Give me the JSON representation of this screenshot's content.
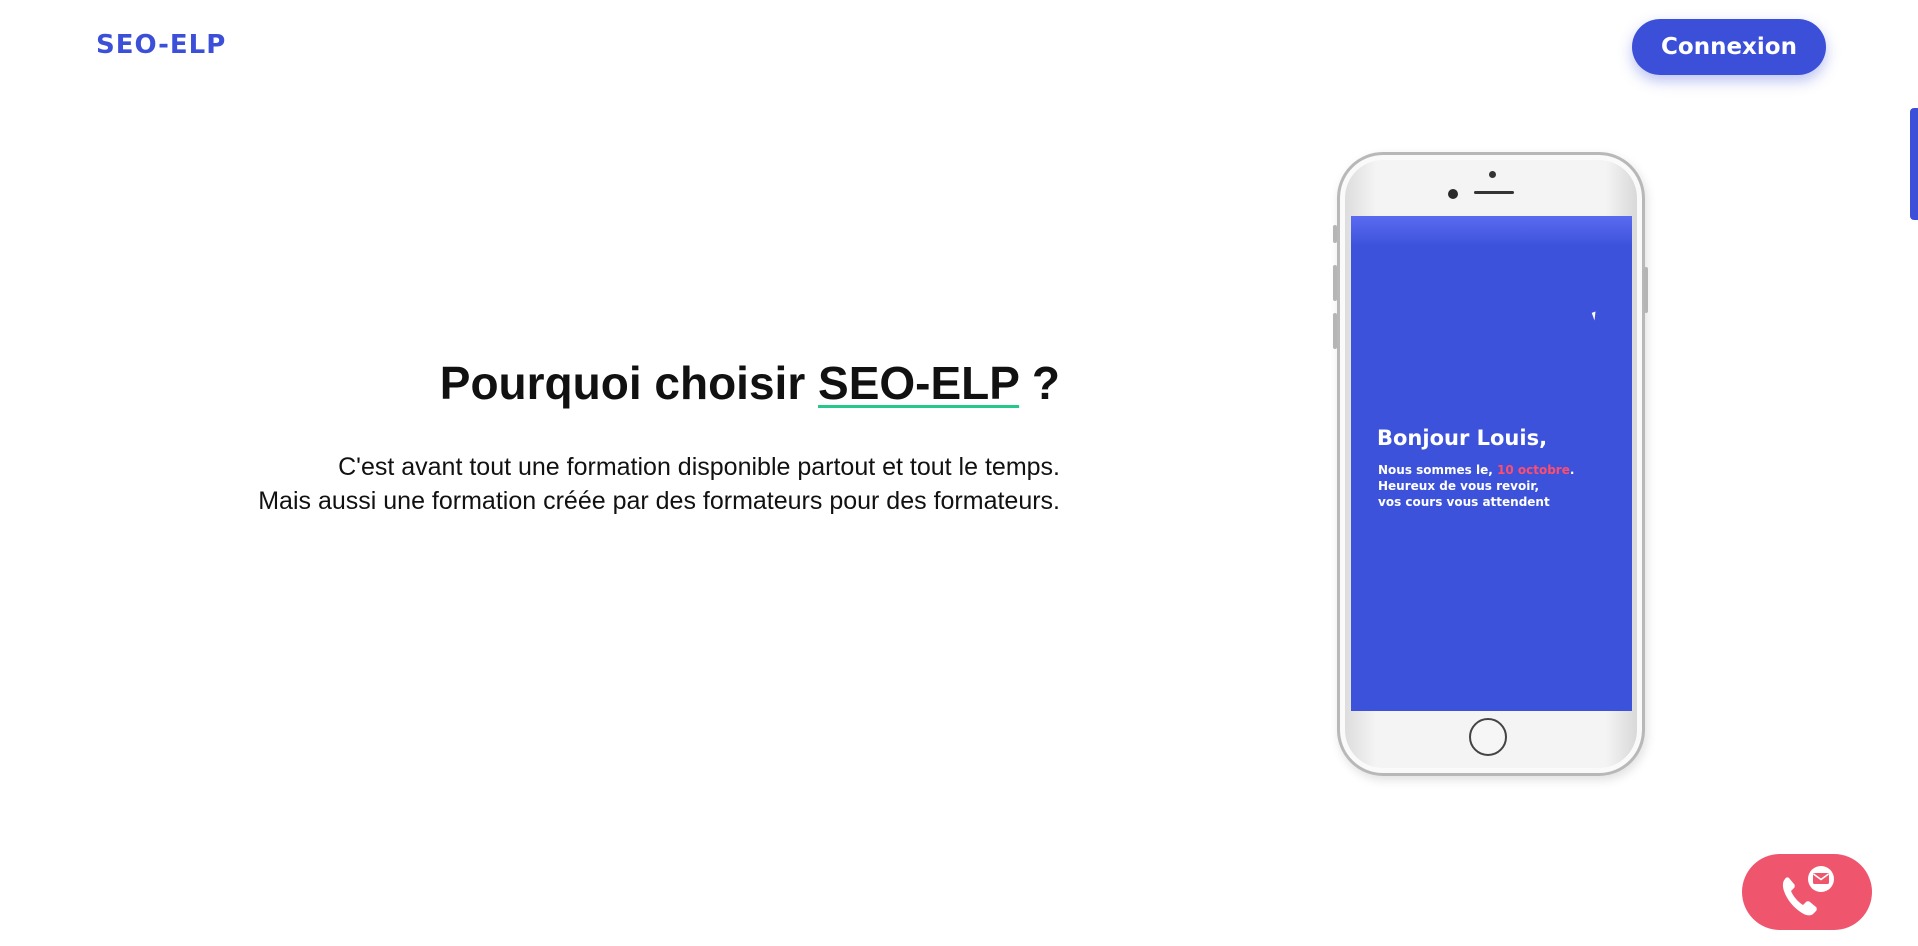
{
  "header": {
    "logo": "SEO-ELP",
    "login_label": "Connexion"
  },
  "hero": {
    "title_prefix": "Pourquoi choisir ",
    "title_brand": "SEO-ELP",
    "title_suffix": " ?",
    "description_line1": "C'est avant tout une formation disponible partout et tout le temps.",
    "description_line2": "Mais aussi une formation créée par des formateurs pour des formateurs."
  },
  "phone_screen": {
    "greeting": "Bonjour Louis,",
    "message_prefix": "Nous sommes le, ",
    "message_date": "10 octobre",
    "message_date_suffix": ".",
    "message_line2": "Heureux de vous revoir,",
    "message_line3": "vos cours vous attendent"
  },
  "contact_fab": {
    "icon": "phone-mail-icon"
  },
  "colors": {
    "brand_blue": "#3b4fd8",
    "accent_green": "#27c78a",
    "fab_pink": "#f0556e",
    "date_highlight": "#ff4d6b"
  }
}
